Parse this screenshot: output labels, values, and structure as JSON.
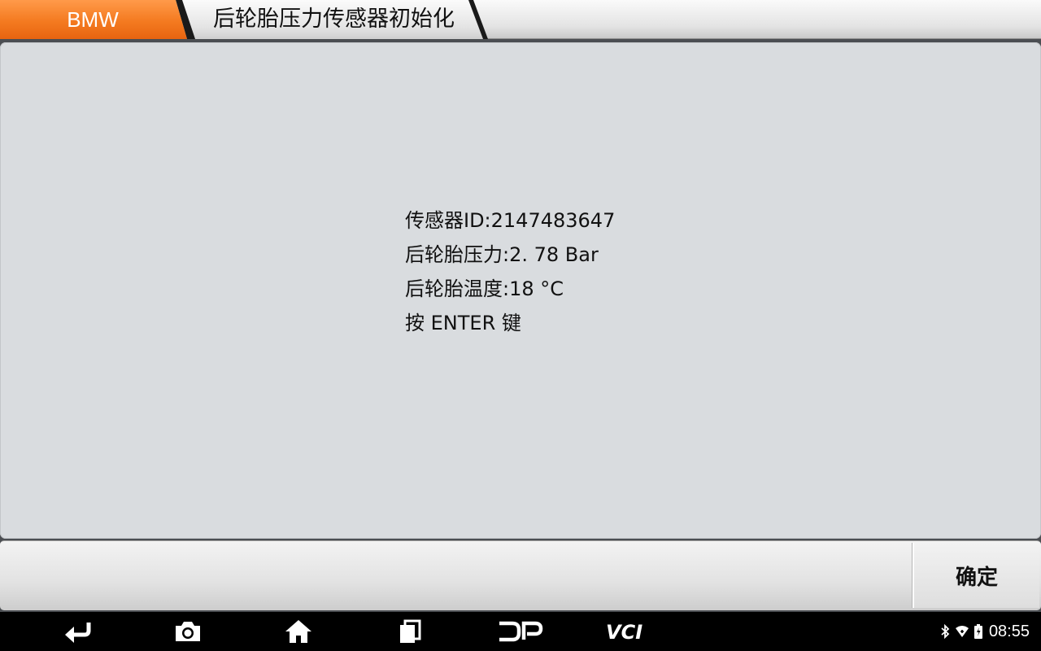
{
  "breadcrumb": {
    "brand": "BMW",
    "title": "后轮胎压力传感器初始化"
  },
  "info_lines": [
    "传感器ID:2147483647",
    "后轮胎压力:2. 78 Bar",
    "后轮胎温度:18 °C",
    "按 ENTER 键"
  ],
  "actions": {
    "confirm_label": "确定"
  },
  "status_bar": {
    "time": "08:55"
  },
  "nav_icons": [
    "back-icon",
    "camera-icon",
    "home-icon",
    "recent-apps-icon",
    "dp-icon",
    "vci-icon"
  ],
  "status_icons": [
    "bluetooth-icon",
    "wifi-icon",
    "battery-icon"
  ],
  "colors": {
    "brand_orange": "#f47a20",
    "panel_bg": "#d9dcdf",
    "navbar_bg": "#000000"
  }
}
